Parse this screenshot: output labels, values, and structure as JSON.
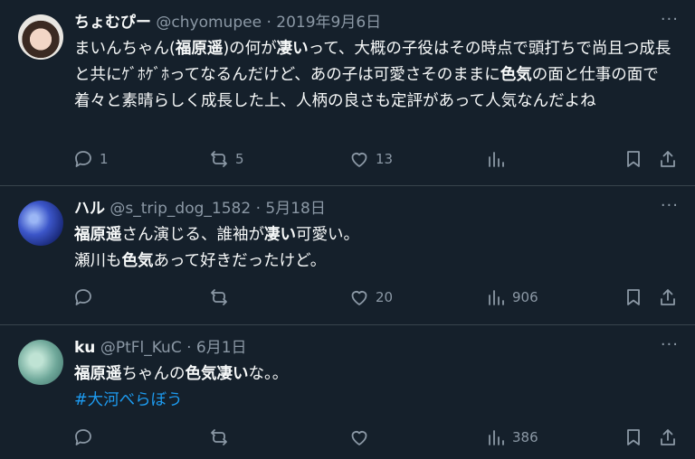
{
  "tweets": [
    {
      "name": "ちょむぴー",
      "handle": "@chyomupee",
      "dot": " · ",
      "date": "2019年9月6日",
      "more": "···",
      "text": [
        {
          "t": "まいんちゃん(",
          "b": false
        },
        {
          "t": "福原遥",
          "b": true
        },
        {
          "t": ")の何が",
          "b": false
        },
        {
          "t": "凄い",
          "b": true
        },
        {
          "t": "って、大概の子役はその時点で頭打ちで尚且つ成長と共にｹﾞﾎｹﾞﾎってなるんだけど、あの子は可愛さそのままに",
          "b": false
        },
        {
          "t": "色気",
          "b": true
        },
        {
          "t": "の面と仕事の面で着々と素晴らしく成長した上、人柄の良さも定評があって人気なんだよね",
          "b": false
        }
      ],
      "hashtag": "",
      "reply_count": "1",
      "retweet_count": "5",
      "like_count": "13",
      "view_count": ""
    },
    {
      "name": "ハル",
      "handle": "@s_trip_dog_1582",
      "dot": " · ",
      "date": "5月18日",
      "more": "···",
      "lines": [
        [
          {
            "t": "福原遥",
            "b": true
          },
          {
            "t": "さん演じる、誰袖が",
            "b": false
          },
          {
            "t": "凄い",
            "b": true
          },
          {
            "t": "可愛い。",
            "b": false
          }
        ],
        [
          {
            "t": "瀬川も",
            "b": false
          },
          {
            "t": "色気",
            "b": true
          },
          {
            "t": "あって好きだったけど。",
            "b": false
          }
        ]
      ],
      "hashtag": "",
      "reply_count": "",
      "retweet_count": "",
      "like_count": "20",
      "view_count": "906"
    },
    {
      "name": "ku",
      "handle": "@PtFl_KuC",
      "dot": " · ",
      "date": "6月1日",
      "more": "···",
      "lines": [
        [
          {
            "t": "福原遥",
            "b": true
          },
          {
            "t": "ちゃんの",
            "b": false
          },
          {
            "t": "色気凄い",
            "b": true
          },
          {
            "t": "な。。",
            "b": false
          }
        ]
      ],
      "hashtag": "#大河べらぼう",
      "reply_count": "",
      "retweet_count": "",
      "like_count": "",
      "view_count": "386"
    }
  ]
}
